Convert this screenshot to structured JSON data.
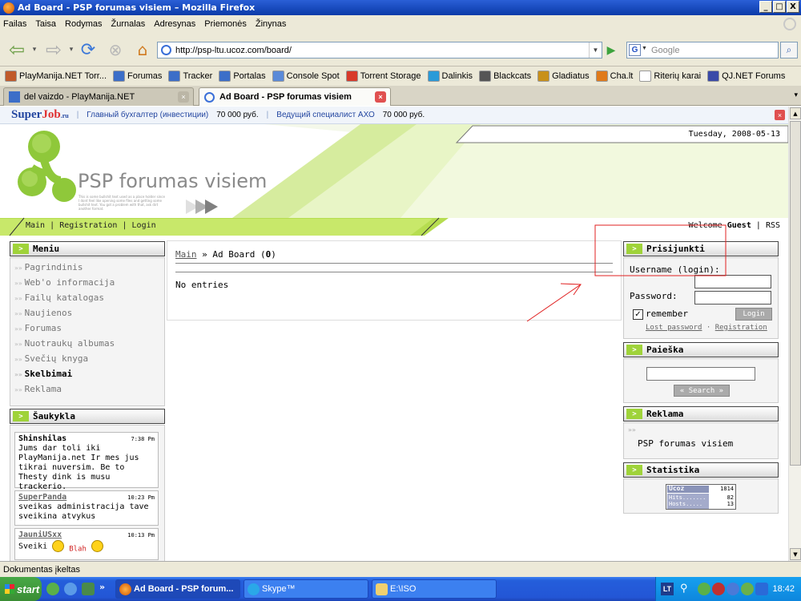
{
  "window": {
    "title": "Ad Board - PSP forumas visiem – Mozilla Firefox",
    "min": "_",
    "max": "□",
    "close": "X"
  },
  "menubar": [
    "Failas",
    "Taisa",
    "Rodymas",
    "Žurnalas",
    "Adresynas",
    "Priemonės",
    "Žinynas"
  ],
  "navigation": {
    "url": "http://psp-ltu.ucoz.com/board/",
    "search_placeholder": "Google",
    "search_engine_letter": "G"
  },
  "bookmarks": [
    {
      "label": "PlayManija.NET Torr...",
      "color": "#c05a2a"
    },
    {
      "label": "Forumas",
      "color": "#3c6ec8"
    },
    {
      "label": "Tracker",
      "color": "#3c6ec8"
    },
    {
      "label": "Portalas",
      "color": "#3c6ec8"
    },
    {
      "label": "Console Spot",
      "color": "#5a8ad8"
    },
    {
      "label": "Torrent Storage",
      "color": "#d83a2a"
    },
    {
      "label": "Dalinkis",
      "color": "#2a9ad8"
    },
    {
      "label": "Blackcats",
      "color": "#555555"
    },
    {
      "label": "Gladiatus",
      "color": "#c8901a"
    },
    {
      "label": "Cha.lt",
      "color": "#e07a1a"
    },
    {
      "label": "Riterių karai",
      "color": "#ffffff"
    },
    {
      "label": "QJ.NET Forums",
      "color": "#3a4aa8"
    }
  ],
  "tabs": [
    {
      "label": "del vaizdo - PlayManija.NET",
      "close": "×"
    },
    {
      "label": "Ad Board - PSP forumas visiem",
      "close": "×"
    }
  ],
  "tab_list_arrow": "▾",
  "superjob": {
    "logo_a": "Super",
    "logo_b": "Job",
    "logo_ru": ".ru",
    "sep": "|",
    "job1": "Главный бухгалтер (инвестиции)",
    "price1": "70 000 руб.",
    "job2": "Ведущий специалист АХО",
    "price2": "70 000 руб.",
    "close": "×"
  },
  "header": {
    "date": "Tuesday, 2008-05-13",
    "site_title": "PSP forumas visiem",
    "slogan": "This is some bullshit text used as a place holder since I dont feel like opening some files and getting some bullshit text. You got a problem with that, ask dirt another format.",
    "nav_main": "Main",
    "nav_sep": "|",
    "nav_registration": "Registration",
    "nav_login": "Login",
    "welcome_prefix": "Welcome",
    "welcome_user": "Guest",
    "rss": "RSS"
  },
  "block_arrow": ">",
  "menu": {
    "title": "Meniu",
    "item_prefix": "»»",
    "items": [
      "Pagrindinis",
      "Web'o informacija",
      "Failų katalogas",
      "Naujienos",
      "Forumas",
      "Nuotraukų albumas",
      "Svečių knyga",
      "Skelbimai",
      "Reklama"
    ],
    "active": "Skelbimai"
  },
  "shoutbox": {
    "title": "Šaukykla",
    "messages": [
      {
        "name": "Shinshilas",
        "time": "7:38 Pm",
        "text": "Jums dar toli iki PlayManija.net Ir mes jus tikrai nuversim. Be to Thesty dink is musu trackerio."
      },
      {
        "name": "SuperPanda",
        "time": "10:23 Pm",
        "text": "sveikas administracija tave sveikina atvykus"
      },
      {
        "name": "JauniUSxx",
        "time": "10:13 Pm",
        "text": "Sveiki",
        "extra": "Blah"
      }
    ]
  },
  "main": {
    "breadcrumb_link": "Main",
    "breadcrumb_sep": "»",
    "breadcrumb_page": "Ad Board",
    "count_open": "(",
    "count": "0",
    "count_close": ")",
    "no_entries": "No entries"
  },
  "login": {
    "title": "Prisijunkti",
    "username_label": "Username (login):",
    "password_label": "Password:",
    "remember_label": "remember",
    "remember_checked": true,
    "login_button": "Login",
    "lost_password": "Lost password",
    "link_sep": "·",
    "registration": "Registration"
  },
  "search": {
    "title": "Paieška",
    "button": "« Search »"
  },
  "ads": {
    "title": "Reklama",
    "prefix": "»»",
    "text": "PSP forumas visiem"
  },
  "stats": {
    "title": "Statistika",
    "logo": "Ucoz",
    "total": "1814",
    "hits_label": "Hits.......",
    "hits": "82",
    "hosts_label": "Hosts.....",
    "hosts": "13"
  },
  "status": "Dokumentas įkeltas",
  "taskbar": {
    "start": "start",
    "chevron": "»",
    "buttons": [
      "Ad Board - PSP forum...",
      "Skype™",
      "E:\\ISO"
    ],
    "lang": "LT",
    "clock": "18:42"
  },
  "annotation_color": "#e02020",
  "accent_green": "#9fd33a"
}
